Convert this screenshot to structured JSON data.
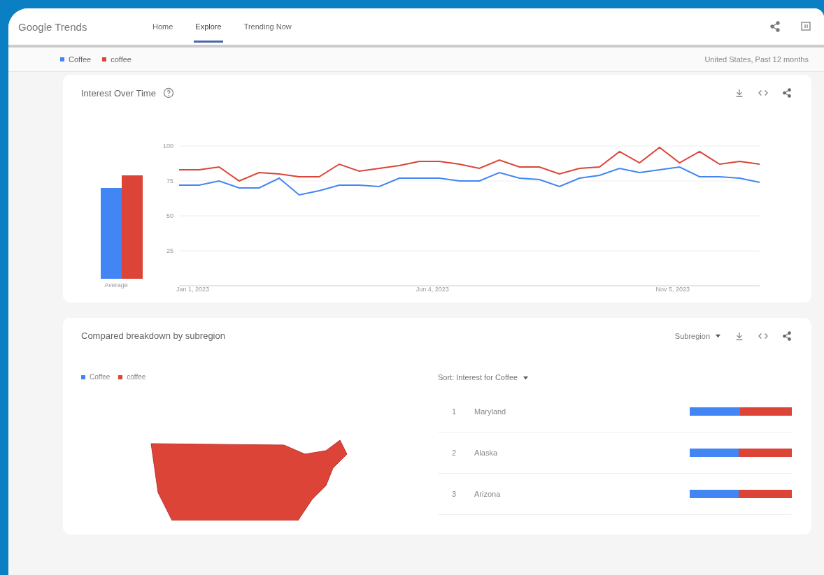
{
  "header": {
    "logo": "Google Trends",
    "nav": [
      {
        "label": "Home",
        "selected": false
      },
      {
        "label": "Explore",
        "selected": true
      },
      {
        "label": "Trending Now",
        "selected": false
      }
    ]
  },
  "terms": [
    {
      "label": "Coffee",
      "color": "#4285f4"
    },
    {
      "label": "coffee",
      "color": "#db4437"
    }
  ],
  "scope": "United States, Past 12 months",
  "interest_over_time": {
    "title": "Interest Over Time",
    "average_label": "Average",
    "x_labels": [
      "Jan 1, 2023",
      "Jun 4, 2023",
      "Nov 5, 2023"
    ],
    "chart_data": {
      "type": "line",
      "grid": true,
      "ylim": [
        0,
        100
      ],
      "yticks": [
        25,
        50,
        75,
        100
      ],
      "series": [
        {
          "color": "#4285f4",
          "values": [
            72,
            72,
            75,
            70,
            70,
            77,
            65,
            68,
            72,
            72,
            71,
            77,
            77,
            77,
            75,
            75,
            81,
            77,
            76,
            71,
            77,
            79,
            84,
            81,
            83,
            85,
            78,
            78,
            77,
            74
          ]
        },
        {
          "color": "#db4437",
          "values": [
            83,
            83,
            85,
            75,
            81,
            80,
            78,
            78,
            87,
            82,
            84,
            86,
            89,
            89,
            87,
            84,
            90,
            85,
            85,
            80,
            84,
            85,
            96,
            88,
            99,
            88,
            96,
            87,
            89,
            87
          ]
        }
      ]
    }
  },
  "subregion": {
    "title": "Compared breakdown by subregion",
    "legend": [
      {
        "label": "Coffee",
        "color": "#4285f4"
      },
      {
        "label": "coffee",
        "color": "#db4437"
      }
    ],
    "level_menu": "Subregion",
    "sort_label": "Sort:",
    "sort_value": "Interest for Coffee",
    "rows": [
      {
        "rank": "1",
        "name": "Maryland",
        "level": 0.49
      },
      {
        "rank": "2",
        "name": "Alaska",
        "level": 0.48
      },
      {
        "rank": "3",
        "name": "Arizona",
        "level": 0.48
      }
    ]
  }
}
